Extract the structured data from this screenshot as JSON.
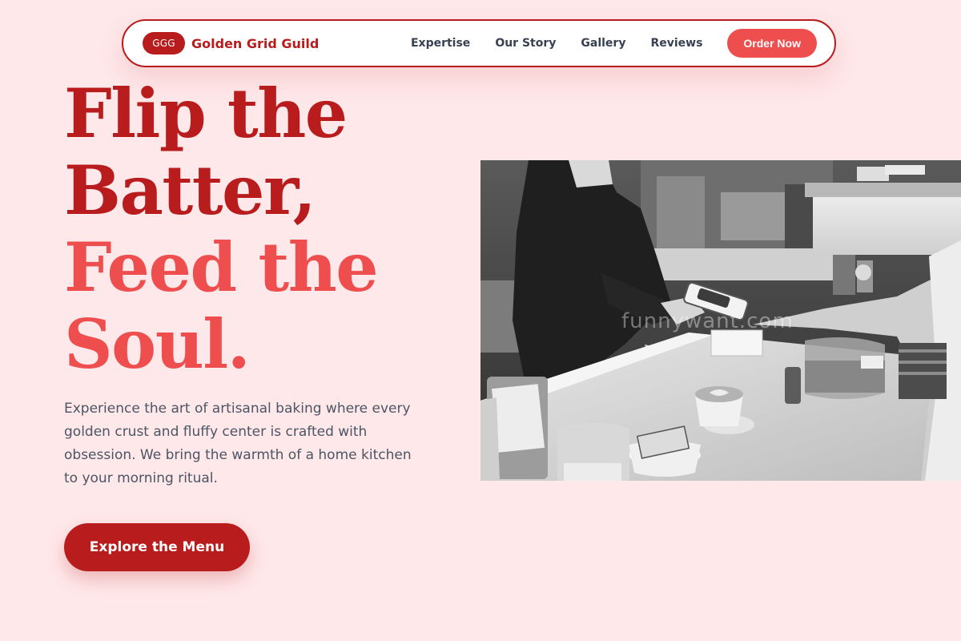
{
  "brand": {
    "badge": "GGG",
    "name": "Golden Grid Guild"
  },
  "nav": {
    "links": [
      {
        "label": "Expertise"
      },
      {
        "label": "Our Story"
      },
      {
        "label": "Gallery"
      },
      {
        "label": "Reviews"
      }
    ],
    "cta_label": "Order Now"
  },
  "hero": {
    "title_lines": [
      "Flip the",
      "Batter,",
      "Feed the",
      "Soul."
    ],
    "description": "Experience the art of artisanal baking where every golden crust and fluffy center is crafted with obsession. We bring the warmth of a home kitchen to your morning ritual.",
    "cta_label": "Explore the Menu"
  },
  "photo": {
    "subject": "black-and-white cafe counter with card payment",
    "watermark": "funnywant.com"
  },
  "colors": {
    "page_background": "#ffe8ea",
    "primary_red": "#b91c1c",
    "accent_coral": "#ef4e4e",
    "body_text": "#4b5563",
    "nav_text": "#374151"
  }
}
